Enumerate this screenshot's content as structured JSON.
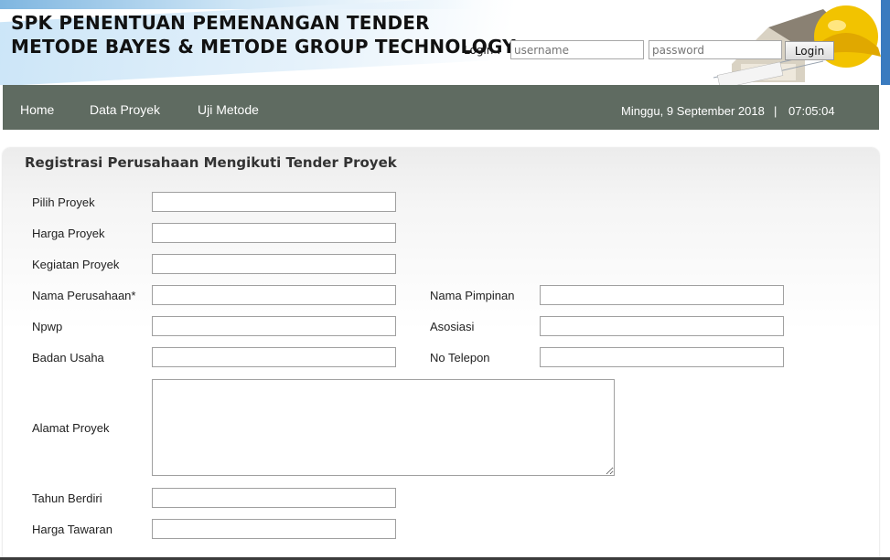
{
  "header": {
    "title_line1": "SPK PENENTUAN PEMENANGAN TENDER",
    "title_line2": "METODE BAYES & METODE GROUP TECHNOLOGY",
    "login_label": "Login :",
    "username_placeholder": "username",
    "password_placeholder": "password",
    "login_button": "Login"
  },
  "nav": {
    "items": [
      "Home",
      "Data Proyek",
      "Uji Metode"
    ],
    "date": "Minggu, 9 September 2018",
    "separator": "|",
    "time": "07:05:04"
  },
  "form": {
    "title": "Registrasi Perusahaan Mengikuti Tender Proyek",
    "labels": {
      "pilih_proyek": "Pilih Proyek",
      "harga_proyek": "Harga Proyek",
      "kegiatan_proyek": "Kegiatan Proyek",
      "nama_perusahaan": "Nama Perusahaan*",
      "npwp": "Npwp",
      "badan_usaha": "Badan Usaha",
      "alamat_proyek": "Alamat Proyek",
      "tahun_berdiri": "Tahun Berdiri",
      "harga_tawaran": "Harga Tawaran",
      "nama_pimpinan": "Nama Pimpinan",
      "asosiasi": "Asosiasi",
      "no_telepon": "No Telepon"
    }
  },
  "colors": {
    "nav_bg": "#5f6b61",
    "header_accent": "#c9e4f7"
  }
}
